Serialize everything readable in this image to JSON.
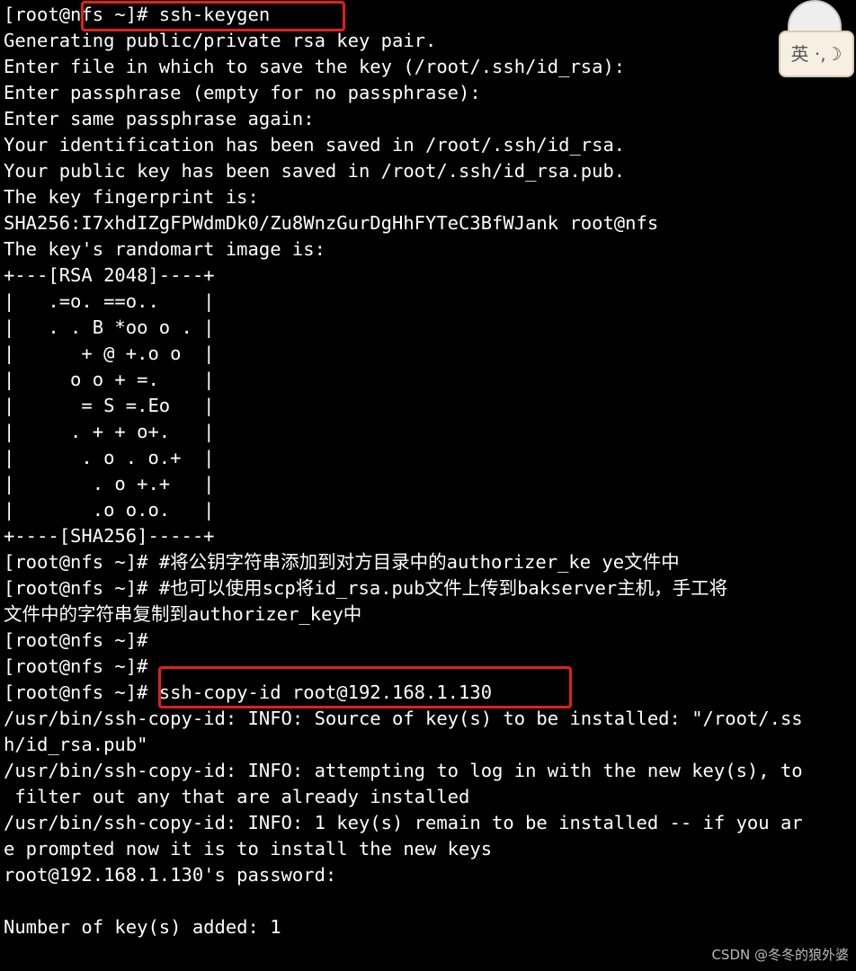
{
  "terminal": {
    "lines": [
      "[root@nfs ~]# ssh-keygen",
      "Generating public/private rsa key pair.",
      "Enter file in which to save the key (/root/.ssh/id_rsa):",
      "Enter passphrase (empty for no passphrase):",
      "Enter same passphrase again:",
      "Your identification has been saved in /root/.ssh/id_rsa.",
      "Your public key has been saved in /root/.ssh/id_rsa.pub.",
      "The key fingerprint is:",
      "SHA256:I7xhdIZgFPWdmDk0/Zu8WnzGurDgHhFYTeC3BfWJank root@nfs",
      "The key's randomart image is:",
      "+---[RSA 2048]----+",
      "|   .=o. ==o..    |",
      "|   . . B *oo o . |",
      "|      + @ +.o o  |",
      "|     o o + =.    |",
      "|      = S =.Eo   |",
      "|     . + + o+.   |",
      "|      . o . o.+  |",
      "|       . o +.+   |",
      "|       .o o.o.   |",
      "+----[SHA256]-----+",
      "[root@nfs ~]# #将公钥字符串添加到对方目录中的authorizer_ke ye文件中",
      "[root@nfs ~]# #也可以使用scp将id_rsa.pub文件上传到bakserver主机，手工将",
      "文件中的字符串复制到authorizer_key中",
      "[root@nfs ~]#",
      "[root@nfs ~]#",
      "[root@nfs ~]# ssh-copy-id root@192.168.1.130",
      "/usr/bin/ssh-copy-id: INFO: Source of key(s) to be installed: \"/root/.ss",
      "h/id_rsa.pub\"",
      "/usr/bin/ssh-copy-id: INFO: attempting to log in with the new key(s), to",
      " filter out any that are already installed",
      "/usr/bin/ssh-copy-id: INFO: 1 key(s) remain to be installed -- if you ar",
      "e prompted now it is to install the new keys",
      "root@192.168.1.130's password:",
      "",
      "Number of key(s) added: 1"
    ]
  },
  "ime_indicator": {
    "label": "英 ·,☽"
  },
  "watermark": "CSDN @冬冬的狼外婆",
  "colors": {
    "background": "#000000",
    "text": "#ffffff",
    "highlight": "#e02020"
  }
}
